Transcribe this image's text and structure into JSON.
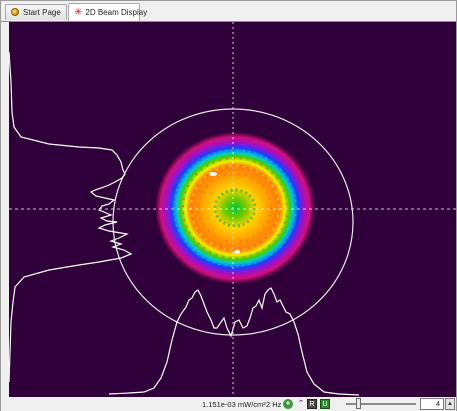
{
  "tabs": [
    {
      "label": "Start Page",
      "icon": "globe-icon"
    },
    {
      "label": "2D Beam Display",
      "icon": "beam-icon"
    }
  ],
  "status": {
    "power_density": "1.151e-03 mW/cm²",
    "frame_rate": "2 Hz",
    "palette_value": "4"
  },
  "colors": {
    "background": "#2f003a",
    "crosshair": "#ffffff",
    "profile_line": "#ffffff",
    "palette": [
      "#6a0a8a",
      "#c01aa0",
      "#ff1a3a",
      "#ff7a00",
      "#ffcc00",
      "#c8f000",
      "#00d000",
      "#00c8ff",
      "#2020ff"
    ]
  },
  "beam": {
    "shape": "round",
    "overlay": "circular aperture with crosshair",
    "profiles": [
      "horizontal",
      "vertical"
    ]
  },
  "statusbar_icons": [
    "status-green-icon",
    "up-arrow-icon",
    "record-icon",
    "u-mode-icon"
  ]
}
